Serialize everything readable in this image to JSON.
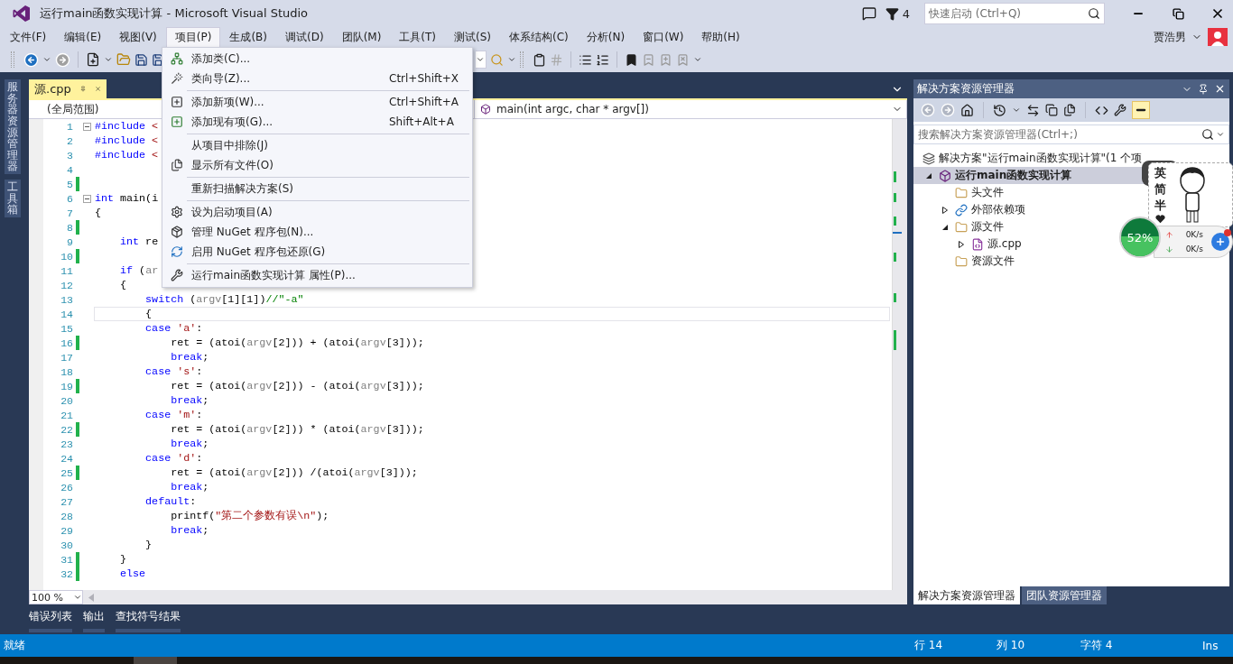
{
  "window": {
    "title": "运行main函数实现计算 - Microsoft Visual Studio",
    "notifications": "4",
    "quick_launch": {
      "placeholder": "快速启动 (Ctrl+Q)"
    }
  },
  "menu_bar": {
    "items": [
      {
        "label": "文件(F)",
        "selected": false
      },
      {
        "label": "编辑(E)",
        "selected": false
      },
      {
        "label": "视图(V)",
        "selected": false
      },
      {
        "label": "项目(P)",
        "selected": true
      },
      {
        "label": "生成(B)",
        "selected": false
      },
      {
        "label": "调试(D)",
        "selected": false
      },
      {
        "label": "团队(M)",
        "selected": false
      },
      {
        "label": "工具(T)",
        "selected": false
      },
      {
        "label": "测试(S)",
        "selected": false
      },
      {
        "label": "体系结构(C)",
        "selected": false
      },
      {
        "label": "分析(N)",
        "selected": false
      },
      {
        "label": "窗口(W)",
        "selected": false
      },
      {
        "label": "帮助(H)",
        "selected": false
      }
    ],
    "user": "贾浩男"
  },
  "dropdown_menu": {
    "groups": [
      [
        {
          "label": "添加类(C)..."
        },
        {
          "label": "类向导(Z)...",
          "shortcut": "Ctrl+Shift+X"
        }
      ],
      [
        {
          "label": "添加新项(W)...",
          "shortcut": "Ctrl+Shift+A"
        },
        {
          "label": "添加现有项(G)...",
          "shortcut": "Shift+Alt+A"
        }
      ],
      [
        {
          "label": "从项目中排除(J)"
        },
        {
          "label": "显示所有文件(O)"
        }
      ],
      [
        {
          "label": "重新扫描解决方案(S)"
        }
      ],
      [
        {
          "label": "设为启动项目(A)"
        },
        {
          "label": "管理 NuGet 程序包(N)..."
        },
        {
          "label": "启用 NuGet 程序包还原(G)"
        }
      ],
      [
        {
          "label": "运行main函数实现计算 属性(P)..."
        }
      ]
    ]
  },
  "side_tabs": [
    "服务器资源管理器",
    "工具箱"
  ],
  "editor": {
    "tabs": [
      {
        "label": "源.cpp",
        "selected": true
      }
    ],
    "scope": "(全局范围)",
    "member": "main(int argc, char * argv[])",
    "zoom": "100 %",
    "lines": [
      {
        "n": "1",
        "tokens": [
          {
            "kind": "kw",
            "text": "#include"
          },
          {
            "kind": "str",
            "text": " <"
          }
        ],
        "changed": false,
        "fold": true,
        "current": false
      },
      {
        "n": "2",
        "tokens": [
          {
            "kind": "kw",
            "text": "#include"
          },
          {
            "kind": "str",
            "text": " <"
          }
        ],
        "changed": false,
        "fold": false,
        "current": false
      },
      {
        "n": "3",
        "tokens": [
          {
            "kind": "kw",
            "text": "#include"
          },
          {
            "kind": "str",
            "text": " <"
          }
        ],
        "changed": false,
        "fold": false,
        "current": false
      },
      {
        "n": "4",
        "changed": false,
        "fold": false,
        "current": false
      },
      {
        "n": "5",
        "changed": true,
        "fold": false,
        "current": false
      },
      {
        "n": "6",
        "tokens": [
          {
            "kind": "kw",
            "text": "int"
          },
          {
            "kind": "txt",
            "text": " main(i"
          }
        ],
        "changed": false,
        "fold": true,
        "current": false
      },
      {
        "n": "7",
        "tokens": [
          {
            "kind": "txt",
            "text": "{"
          }
        ],
        "changed": false,
        "fold": false,
        "current": false
      },
      {
        "n": "8",
        "changed": true,
        "fold": false,
        "current": false
      },
      {
        "n": "9",
        "tokens": [
          {
            "kind": "kw",
            "text": "    int"
          },
          {
            "kind": "txt",
            "text": " re"
          }
        ],
        "changed": false,
        "fold": false,
        "current": false
      },
      {
        "n": "10",
        "changed": true,
        "fold": false,
        "current": false
      },
      {
        "n": "11",
        "tokens": [
          {
            "kind": "kw",
            "text": "    if"
          },
          {
            "kind": "txt",
            "text": " ("
          },
          {
            "kind": "param",
            "text": "ar"
          }
        ],
        "changed": false,
        "fold": false,
        "current": false
      },
      {
        "n": "12",
        "tokens": [
          {
            "kind": "txt",
            "text": "    {"
          }
        ],
        "changed": false,
        "fold": false,
        "current": false
      },
      {
        "n": "13",
        "tokens": [
          {
            "kind": "kw",
            "text": "        switch"
          },
          {
            "kind": "txt",
            "text": " ("
          },
          {
            "kind": "param",
            "text": "argv"
          },
          {
            "kind": "txt",
            "text": "[1][1])"
          },
          {
            "kind": "cmt",
            "text": "//\"-a\""
          }
        ],
        "changed": false,
        "fold": false,
        "current": false
      },
      {
        "n": "14",
        "tokens": [
          {
            "kind": "txt",
            "text": "        {"
          }
        ],
        "changed": false,
        "fold": false,
        "current": true
      },
      {
        "n": "15",
        "tokens": [
          {
            "kind": "kw",
            "text": "        case"
          },
          {
            "kind": "str",
            "text": " 'a'"
          },
          {
            "kind": "txt",
            "text": ":"
          }
        ],
        "changed": false,
        "fold": false,
        "current": false
      },
      {
        "n": "16",
        "tokens": [
          {
            "kind": "txt",
            "text": "            ret = (atoi("
          },
          {
            "kind": "param",
            "text": "argv"
          },
          {
            "kind": "txt",
            "text": "[2])) + (atoi("
          },
          {
            "kind": "param",
            "text": "argv"
          },
          {
            "kind": "txt",
            "text": "[3]));"
          }
        ],
        "changed": true,
        "fold": false,
        "current": false
      },
      {
        "n": "17",
        "tokens": [
          {
            "kind": "kw",
            "text": "            break"
          },
          {
            "kind": "txt",
            "text": ";"
          }
        ],
        "changed": false,
        "fold": false,
        "current": false
      },
      {
        "n": "18",
        "tokens": [
          {
            "kind": "kw",
            "text": "        case"
          },
          {
            "kind": "str",
            "text": " 's'"
          },
          {
            "kind": "txt",
            "text": ":"
          }
        ],
        "changed": false,
        "fold": false,
        "current": false
      },
      {
        "n": "19",
        "tokens": [
          {
            "kind": "txt",
            "text": "            ret = (atoi("
          },
          {
            "kind": "param",
            "text": "argv"
          },
          {
            "kind": "txt",
            "text": "[2])) - (atoi("
          },
          {
            "kind": "param",
            "text": "argv"
          },
          {
            "kind": "txt",
            "text": "[3]));"
          }
        ],
        "changed": true,
        "fold": false,
        "current": false
      },
      {
        "n": "20",
        "tokens": [
          {
            "kind": "kw",
            "text": "            break"
          },
          {
            "kind": "txt",
            "text": ";"
          }
        ],
        "changed": false,
        "fold": false,
        "current": false
      },
      {
        "n": "21",
        "tokens": [
          {
            "kind": "kw",
            "text": "        case"
          },
          {
            "kind": "str",
            "text": " 'm'"
          },
          {
            "kind": "txt",
            "text": ":"
          }
        ],
        "changed": false,
        "fold": false,
        "current": false
      },
      {
        "n": "22",
        "tokens": [
          {
            "kind": "txt",
            "text": "            ret = (atoi("
          },
          {
            "kind": "param",
            "text": "argv"
          },
          {
            "kind": "txt",
            "text": "[2])) * (atoi("
          },
          {
            "kind": "param",
            "text": "argv"
          },
          {
            "kind": "txt",
            "text": "[3]));"
          }
        ],
        "changed": true,
        "fold": false,
        "current": false
      },
      {
        "n": "23",
        "tokens": [
          {
            "kind": "kw",
            "text": "            break"
          },
          {
            "kind": "txt",
            "text": ";"
          }
        ],
        "changed": false,
        "fold": false,
        "current": false
      },
      {
        "n": "24",
        "tokens": [
          {
            "kind": "kw",
            "text": "        case"
          },
          {
            "kind": "str",
            "text": " 'd'"
          },
          {
            "kind": "txt",
            "text": ":"
          }
        ],
        "changed": false,
        "fold": false,
        "current": false
      },
      {
        "n": "25",
        "tokens": [
          {
            "kind": "txt",
            "text": "            ret = (atoi("
          },
          {
            "kind": "param",
            "text": "argv"
          },
          {
            "kind": "txt",
            "text": "[2])) /(atoi("
          },
          {
            "kind": "param",
            "text": "argv"
          },
          {
            "kind": "txt",
            "text": "[3]));"
          }
        ],
        "changed": true,
        "fold": false,
        "current": false
      },
      {
        "n": "26",
        "tokens": [
          {
            "kind": "kw",
            "text": "            break"
          },
          {
            "kind": "txt",
            "text": ";"
          }
        ],
        "changed": false,
        "fold": false,
        "current": false
      },
      {
        "n": "27",
        "tokens": [
          {
            "kind": "kw",
            "text": "        default"
          },
          {
            "kind": "txt",
            "text": ":"
          }
        ],
        "changed": false,
        "fold": false,
        "current": false
      },
      {
        "n": "28",
        "tokens": [
          {
            "kind": "txt",
            "text": "            printf("
          },
          {
            "kind": "str",
            "text": "\"第二个参数有误\\n\""
          },
          {
            "kind": "txt",
            "text": ");"
          }
        ],
        "changed": false,
        "fold": false,
        "current": false
      },
      {
        "n": "29",
        "tokens": [
          {
            "kind": "kw",
            "text": "            break"
          },
          {
            "kind": "txt",
            "text": ";"
          }
        ],
        "changed": false,
        "fold": false,
        "current": false
      },
      {
        "n": "30",
        "tokens": [
          {
            "kind": "txt",
            "text": "        }"
          }
        ],
        "changed": false,
        "fold": false,
        "current": false
      },
      {
        "n": "31",
        "tokens": [
          {
            "kind": "txt",
            "text": "    }"
          }
        ],
        "changed": true,
        "fold": false,
        "current": false
      },
      {
        "n": "32",
        "tokens": [
          {
            "kind": "kw",
            "text": "    else"
          }
        ],
        "changed": true,
        "fold": false,
        "current": false
      }
    ]
  },
  "bottom_tabs": [
    "错误列表",
    "输出",
    "查找符号结果"
  ],
  "solution_explorer": {
    "title": "解决方案资源管理器",
    "search": {
      "placeholder": "搜索解决方案资源管理器(Ctrl+;)"
    },
    "tree": [
      {
        "kind": "solution",
        "label": "解决方案\"运行main函数实现计算\"(1 个项",
        "selected": false,
        "children": [
          {
            "kind": "project",
            "label": "运行main函数实现计算",
            "selected": true,
            "expanded": true,
            "children": [
              {
                "kind": "folder",
                "label": "头文件",
                "selected": false
              },
              {
                "kind": "references",
                "label": "外部依赖项",
                "selected": false,
                "expanded": false
              },
              {
                "kind": "folder",
                "label": "源文件",
                "selected": false,
                "expanded": true,
                "children": [
                  {
                    "kind": "file",
                    "label": "源.cpp",
                    "selected": false,
                    "expanded": false
                  }
                ]
              },
              {
                "kind": "folder",
                "label": "资源文件",
                "selected": false
              }
            ]
          }
        ]
      }
    ],
    "tabs": [
      {
        "label": "解决方案资源管理器",
        "selected": true
      },
      {
        "label": "团队资源管理器",
        "selected": false
      }
    ]
  },
  "overlay_widget": {
    "ime": [
      "英",
      "简",
      "半"
    ],
    "gauge": {
      "reading": "52%"
    },
    "upload": "0K/s",
    "download": "0K/s"
  },
  "status_bar": {
    "message": "就绪",
    "line": "行 14",
    "column": "列 10",
    "char": "字符 4",
    "mode": "Ins"
  }
}
